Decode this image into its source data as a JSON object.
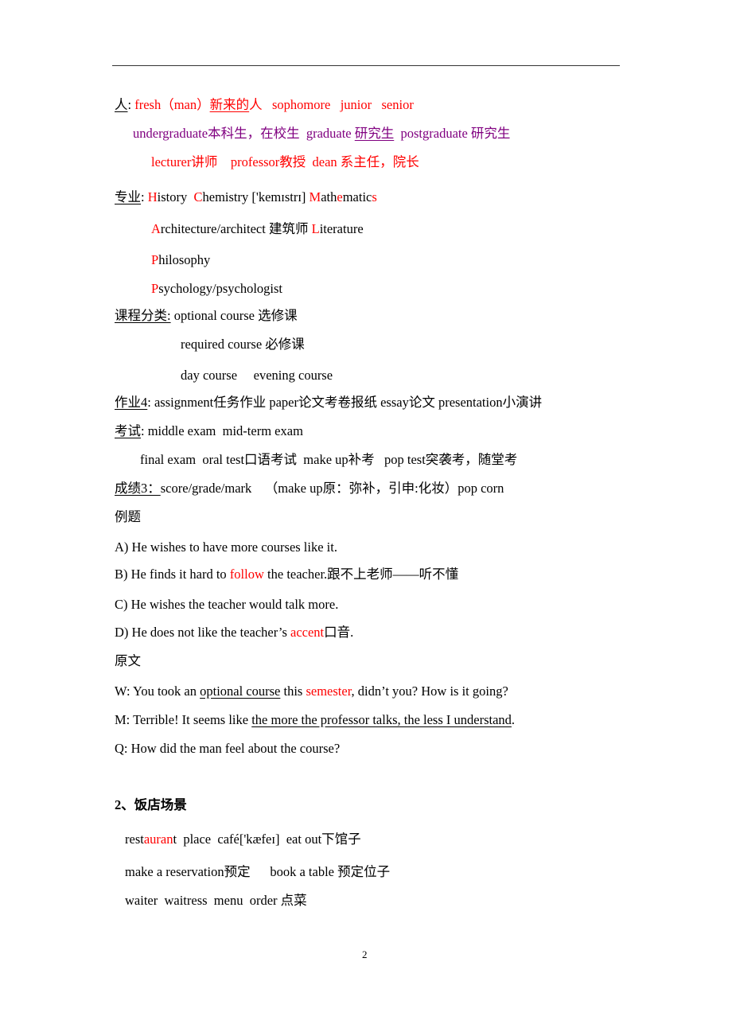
{
  "page_number": "2",
  "colors": {
    "accent_red": "#ff0000",
    "accent_purple": "#800080",
    "text": "#000000"
  },
  "people": {
    "label": "人",
    "colon": ": ",
    "line1": {
      "fresh": "fresh（man）",
      "fresh_cn_underlined": "新来的",
      "fresh_cn_rest": "人",
      "others": "   sophomore   junior   senior"
    },
    "line2": {
      "undergrad": "undergraduate本科生，在校生  graduate ",
      "grad_cn": "研究生",
      "postgrad": "  postgraduate 研究生"
    },
    "line3": "lecturer讲师    professor教授  dean 系主任，院长"
  },
  "majors": {
    "label": "专业",
    "colon": ": ",
    "line1": [
      {
        "t": "H",
        "red": true
      },
      {
        "t": "istory  ",
        "red": false
      },
      {
        "t": "C",
        "red": true
      },
      {
        "t": "hemistry ['kemɪstrɪ] ",
        "red": false
      },
      {
        "t": "M",
        "red": true
      },
      {
        "t": "ath",
        "red": false
      },
      {
        "t": "e",
        "red": true
      },
      {
        "t": "matic",
        "red": false
      },
      {
        "t": "s",
        "red": true
      }
    ],
    "line2": {
      "a": "A",
      "a_rest": "rchitecture/architect 建筑师 ",
      "l": "L",
      "l_rest": "iterature"
    },
    "line3": {
      "p": "P",
      "rest": "hilosophy"
    },
    "line4": {
      "p": "P",
      "rest": "sychology/psychologist"
    }
  },
  "courses": {
    "label": "课程分类:",
    "line1": " optional course 选修课",
    "line2": "required course 必修课",
    "line3": "day course     evening course"
  },
  "homework": {
    "label": "作业4",
    "text": ": assignment任务作业 paper论文考卷报纸 essay论文 presentation小演讲"
  },
  "exams": {
    "label": "考试",
    "line1": ": middle exam  mid-term exam",
    "line2": "final exam  oral test口语考试  make up补考   pop test突袭考，随堂考"
  },
  "grades": {
    "label": "成绩3：",
    "text": "score/grade/mark    （make up原：弥补，引申:化妆）pop corn"
  },
  "example": {
    "heading": "例题",
    "options": {
      "a": "A) He wishes to have more courses like it.",
      "b_pre": "B) He finds it hard to ",
      "b_red": "follow",
      "b_post": " the teacher.跟不上老师——听不懂",
      "c": "C) He wishes the teacher would talk more.",
      "d_pre": "D) He does not like the teacher’s ",
      "d_red": "accent",
      "d_post": "口音."
    }
  },
  "original": {
    "heading": "原文",
    "w_pre": "W: You took an ",
    "w_underlined": "optional course",
    "w_mid": " this ",
    "w_red": "semester",
    "w_post": ", didn’t you? How is it going?",
    "m_pre": "M: Terrible! It seems like ",
    "m_underlined": "the more the professor talks, the less I understand",
    "m_post": ".",
    "q": "Q: How did the man feel about the course?"
  },
  "restaurant": {
    "heading": "2、饭店场景",
    "line1_pre": "rest",
    "line1_red": "auran",
    "line1_post": "t  place  café['kæfeɪ]  eat out下馆子",
    "line2": "make a reservation预定      book a table 预定位子",
    "line3": "waiter  waitress  menu  order 点菜"
  }
}
